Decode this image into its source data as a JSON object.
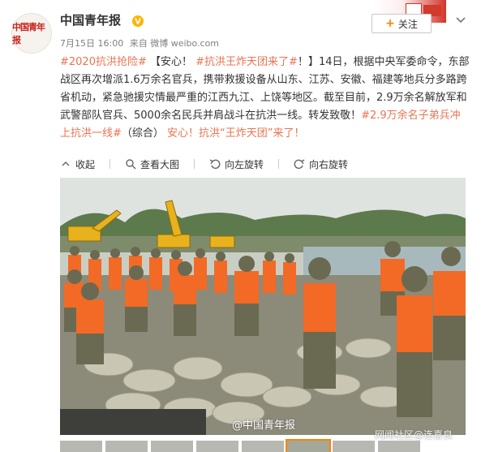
{
  "account": {
    "name": "中国青年报",
    "avatar_text": "中国青年报",
    "time": "7月15日 16:00",
    "source": "来自 微博 weibo.com",
    "follow_label": "关注"
  },
  "post": {
    "segments": [
      {
        "t": "#2020抗洪抢险#",
        "cls": "topic"
      },
      {
        "t": " 【安心！ ",
        "cls": ""
      },
      {
        "t": "#抗洪王炸天团来了#",
        "cls": "topic"
      },
      {
        "t": "！】14日，根据中央军委命令，东部战区再次增派1.6万余名官兵，携带救援设备从山东、江苏、安徽、福建等地兵分多路跨省机动，紧急驰援灾情最严重的江西九江、上饶等地区。截至目前，2.9万余名解放军和武警部队官兵、5000余名民兵并肩战斗在抗洪一线。转发致敬！",
        "cls": ""
      },
      {
        "t": "#2.9万余名子弟兵冲上抗洪一线#",
        "cls": "topic"
      },
      {
        "t": "（综合） ",
        "cls": ""
      },
      {
        "t": "安心！抗洪“王炸天团”来了！",
        "cls": "link"
      }
    ]
  },
  "actions": {
    "collapse": "收起",
    "view_large": "查看大图",
    "rotate_left": "向左旋转",
    "rotate_right": "向右旋转"
  },
  "photo": {
    "watermark": "@中国青年报",
    "watermark2": "网闻社区@连喜良"
  },
  "colors": {
    "topic": "#eb7350",
    "follow_plus": "#ff8200",
    "orange_vest": "#f26a25",
    "camouflage": "#6a6a52"
  }
}
